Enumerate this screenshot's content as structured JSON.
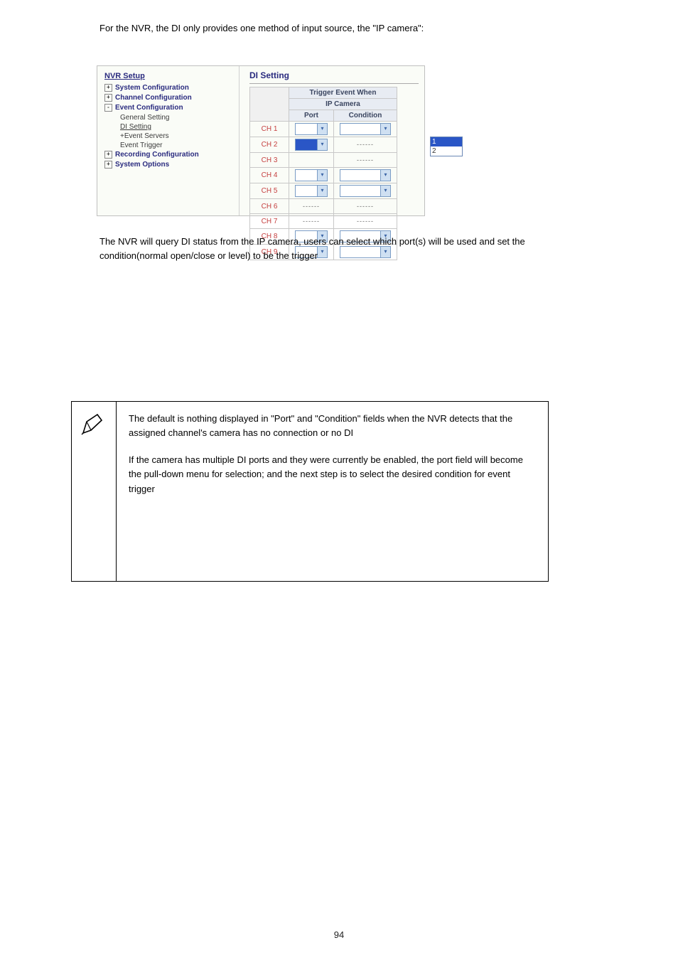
{
  "intro": "For the NVR, the DI only provides one method of input source, the \"IP camera\":",
  "screenshot": {
    "nav": {
      "title": "NVR Setup",
      "items": [
        {
          "sym": "+",
          "label": "System Configuration"
        },
        {
          "sym": "+",
          "label": "Channel Configuration"
        },
        {
          "sym": "-",
          "label": "Event Configuration",
          "children": [
            {
              "label": "General Setting",
              "selected": false,
              "prefix": ""
            },
            {
              "label": "DI Setting",
              "selected": true,
              "prefix": ""
            },
            {
              "label": "Event Servers",
              "selected": false,
              "prefix": "+"
            },
            {
              "label": "Event Trigger",
              "selected": false,
              "prefix": ""
            }
          ]
        },
        {
          "sym": "+",
          "label": "Recording Configuration"
        },
        {
          "sym": "+",
          "label": "System Options"
        }
      ]
    },
    "panel": {
      "title": "DI Setting",
      "header1": "Trigger Event When",
      "header2": "IP Camera",
      "col_port": "Port",
      "col_condition": "Condition",
      "rows": [
        {
          "ch": "CH 1",
          "port_type": "select",
          "cond_type": "select"
        },
        {
          "ch": "CH 2",
          "port_type": "open",
          "cond_type": "dashes"
        },
        {
          "ch": "CH 3",
          "port_type": "none",
          "cond_type": "dashes"
        },
        {
          "ch": "CH 4",
          "port_type": "select",
          "cond_type": "select"
        },
        {
          "ch": "CH 5",
          "port_type": "select",
          "cond_type": "select"
        },
        {
          "ch": "CH 6",
          "port_type": "dashes",
          "cond_type": "dashes"
        },
        {
          "ch": "CH 7",
          "port_type": "dashes",
          "cond_type": "dashes"
        },
        {
          "ch": "CH 8",
          "port_type": "select",
          "cond_type": "select"
        },
        {
          "ch": "CH 9",
          "port_type": "select",
          "cond_type": "select"
        }
      ],
      "dropdown_options": [
        "1",
        "2"
      ]
    }
  },
  "below": "The NVR will query DI status from the IP camera, users can select which port(s) will be used and set the condition(normal open/close or level) to be the trigger",
  "note": {
    "p1": "The default is nothing displayed in \"Port\" and \"Condition\" fields when the NVR detects that the assigned channel's camera has no connection or no DI",
    "p2": "If the camera has multiple DI ports and they were currently be enabled, the port field will become the pull-down menu for selection; and the next step is to select the desired condition for event trigger"
  },
  "page_number": "94"
}
